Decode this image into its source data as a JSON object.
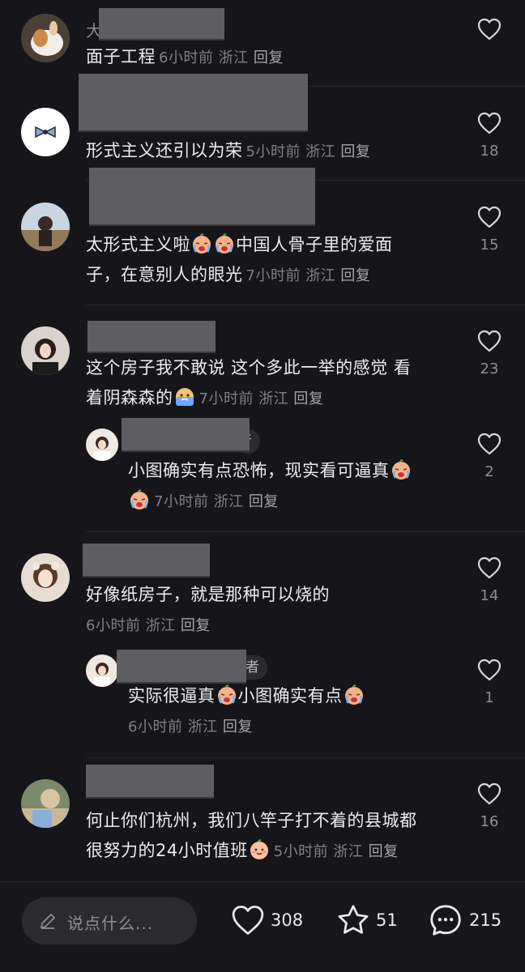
{
  "comments": [
    {
      "name_hint": "大",
      "text": "面子工程",
      "time": "6小时前",
      "location": "浙江",
      "reply_label": "回复",
      "likes": ""
    },
    {
      "text": "形式主义还引以为荣",
      "time": "5小时前",
      "location": "浙江",
      "reply_label": "回复",
      "likes": "18"
    },
    {
      "text_a": "太形式主义啦",
      "text_b": "中国人骨子里的爱面",
      "text_c": "子，在意别人的眼光",
      "time": "7小时前",
      "location": "浙江",
      "reply_label": "回复",
      "likes": "15"
    },
    {
      "text_a": "这个房子我不敢说 这个多此一举的感觉 看",
      "text_b": "着阴森森的",
      "time": "7小时前",
      "location": "浙江",
      "reply_label": "回复",
      "likes": "23",
      "reply": {
        "author_tag": "者",
        "text_a": "小图确实有点恐怖，现实看可逼真",
        "time": "7小时前",
        "location": "浙江",
        "reply_label": "回复",
        "likes": "2"
      }
    },
    {
      "text": "好像纸房子，就是那种可以烧的",
      "time": "6小时前",
      "location": "浙江",
      "reply_label": "回复",
      "likes": "14",
      "reply": {
        "author_tag": "作者",
        "text_a": "实际很逼真",
        "text_b": "小图确实有点",
        "time": "6小时前",
        "location": "浙江",
        "reply_label": "回复",
        "likes": "1"
      }
    },
    {
      "text_a": "何止你们杭州，我们八竿子打不着的县城都",
      "text_b": "很努力的24小时值班",
      "time": "5小时前",
      "location": "浙江",
      "reply_label": "回复",
      "likes": "16"
    }
  ],
  "bottom_bar": {
    "placeholder": "说点什么...",
    "like_count": "308",
    "star_count": "51",
    "comment_count": "215"
  },
  "colors": {
    "background": "#16161a",
    "text": "#ececef",
    "meta": "#7f7f85",
    "redacted": "#5e5e62"
  }
}
